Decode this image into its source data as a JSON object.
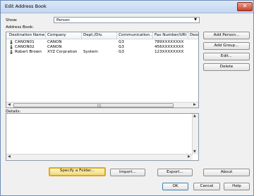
{
  "window": {
    "title": "Edit Address Book",
    "close_glyph": "✕"
  },
  "show": {
    "label": "Show:",
    "value": "Person"
  },
  "address_book": {
    "label": "Address Book:",
    "columns": [
      "Destination Name",
      "Company",
      "Dept./Div.",
      "Communication ...",
      "Fax Number/URI",
      "Desc"
    ],
    "rows": [
      {
        "name": "CANON01",
        "company": "CANON",
        "dept": "",
        "comm": "G3",
        "fax": "789XXXXXXXX"
      },
      {
        "name": "CANON02",
        "company": "CANON",
        "dept": "",
        "comm": "G3",
        "fax": "456XXXXXXXX"
      },
      {
        "name": "Robert Brown",
        "company": "XYZ Corpration",
        "dept": "System",
        "comm": "G3",
        "fax": "123XXXXXXXX"
      }
    ]
  },
  "side_buttons": {
    "add_person": "Add Person...",
    "add_group": "Add Group...",
    "edit": "Edit...",
    "delete": "Delete"
  },
  "details": {
    "label": "Details:"
  },
  "bottom_buttons": {
    "specify_folder": "Specify a Folder...",
    "import": "Import...",
    "export": "Export...",
    "about": "About"
  },
  "dialog_buttons": {
    "ok": "OK",
    "cancel": "Cancel",
    "help": "Help"
  },
  "colors": {
    "focus_border": "#e0a81a",
    "window_border": "#6d8db5"
  },
  "icons": [
    "close-icon",
    "dropdown-arrow-icon",
    "person-icon",
    "scroll-left-icon",
    "scroll-right-icon",
    "scroll-up-icon",
    "scroll-down-icon"
  ]
}
